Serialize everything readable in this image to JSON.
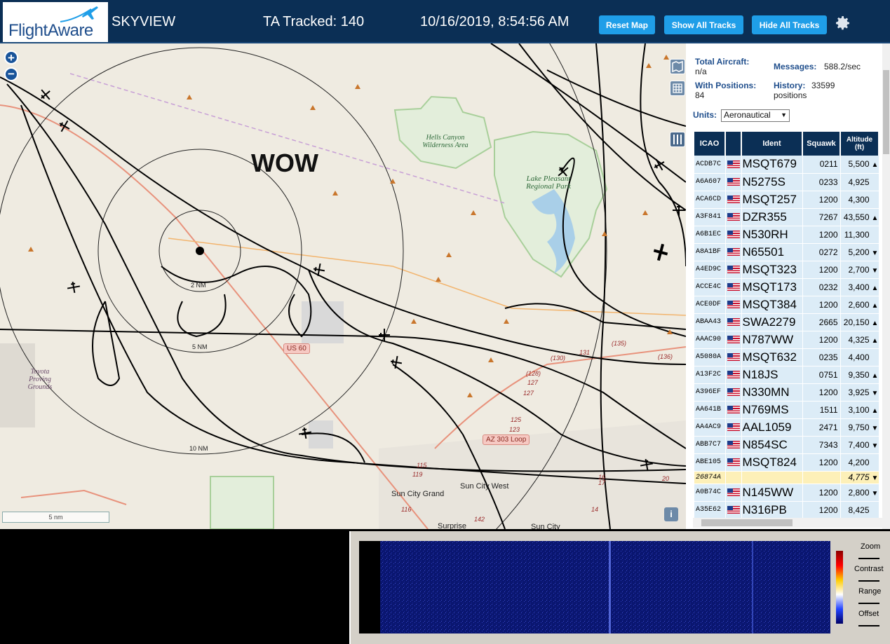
{
  "header": {
    "logo_text": "FlightAware",
    "app_name": "SKYVIEW",
    "tracked": "TA Tracked: 140",
    "datetime": "10/16/2019, 8:54:56 AM",
    "buttons": {
      "reset": "Reset Map",
      "show": "Show All Tracks",
      "hide": "Hide All Tracks"
    }
  },
  "map": {
    "overlay_text": "WOW",
    "range_labels": [
      "2 NM",
      "5 NM",
      "10 NM"
    ],
    "places": {
      "hells_canyon": "Hells Canyon Wilderness Area",
      "lake_pleasant": "Lake Pleasant Regional Park",
      "toyota": "Toyota Proving Grounds",
      "sun_city_grand": "Sun City Grand",
      "sun_city_west": "Sun City West",
      "surprise": "Surprise",
      "sun_city": "Sun City"
    },
    "shields": {
      "us60": "US 60",
      "az303": "AZ 303 Loop"
    },
    "road_numbers": [
      "(130)",
      "131",
      "(135)",
      "(136)",
      "(128)",
      "127",
      "127",
      "125",
      "123",
      "119",
      "116",
      "115",
      "142",
      "17",
      "16",
      "14",
      "20"
    ],
    "scale": "5 nm",
    "info": "i"
  },
  "sidebar": {
    "total_aircraft_label": "Total Aircraft:",
    "total_aircraft_value": "n/a",
    "with_positions_label": "With Positions:",
    "with_positions_value": "84",
    "messages_label": "Messages:",
    "messages_value": "588.2/sec",
    "history_label": "History:",
    "history_value": "33599",
    "history_unit": "positions",
    "units_label": "Units:",
    "units_value": "Aeronautical",
    "columns": [
      "ICAO",
      "",
      "Ident",
      "Squawk",
      "Altitude (ft)"
    ],
    "rows": [
      {
        "icao": "ACDB7C",
        "ident": "MSQT679",
        "squawk": "0211",
        "alt": "5,500",
        "trend": "▲"
      },
      {
        "icao": "A6A607",
        "ident": "N5275S",
        "squawk": "0233",
        "alt": "4,925",
        "trend": ""
      },
      {
        "icao": "ACA6CD",
        "ident": "MSQT257",
        "squawk": "1200",
        "alt": "4,300",
        "trend": ""
      },
      {
        "icao": "A3F841",
        "ident": "DZR355",
        "squawk": "7267",
        "alt": "43,550",
        "trend": "▲"
      },
      {
        "icao": "A6B1EC",
        "ident": "N530RH",
        "squawk": "1200",
        "alt": "11,300",
        "trend": ""
      },
      {
        "icao": "A8A1BF",
        "ident": "N65501",
        "squawk": "0272",
        "alt": "5,200",
        "trend": "▼"
      },
      {
        "icao": "A4ED9C",
        "ident": "MSQT323",
        "squawk": "1200",
        "alt": "2,700",
        "trend": "▼"
      },
      {
        "icao": "ACCE4C",
        "ident": "MSQT173",
        "squawk": "0232",
        "alt": "3,400",
        "trend": "▲"
      },
      {
        "icao": "ACE0DF",
        "ident": "MSQT384",
        "squawk": "1200",
        "alt": "2,600",
        "trend": "▲"
      },
      {
        "icao": "ABAA43",
        "ident": "SWA2279",
        "squawk": "2665",
        "alt": "20,150",
        "trend": "▲"
      },
      {
        "icao": "AAAC90",
        "ident": "N787WW",
        "squawk": "1200",
        "alt": "4,325",
        "trend": "▲"
      },
      {
        "icao": "A5080A",
        "ident": "MSQT632",
        "squawk": "0235",
        "alt": "4,400",
        "trend": ""
      },
      {
        "icao": "A13F2C",
        "ident": "N18JS",
        "squawk": "0751",
        "alt": "9,350",
        "trend": "▲"
      },
      {
        "icao": "A396EF",
        "ident": "N330MN",
        "squawk": "1200",
        "alt": "3,925",
        "trend": "▼"
      },
      {
        "icao": "AA641B",
        "ident": "N769MS",
        "squawk": "1511",
        "alt": "3,100",
        "trend": "▲"
      },
      {
        "icao": "AA4AC9",
        "ident": "AAL1059",
        "squawk": "2471",
        "alt": "9,750",
        "trend": "▼"
      },
      {
        "icao": "ABB7C7",
        "ident": "N854SC",
        "squawk": "7343",
        "alt": "7,400",
        "trend": "▼"
      },
      {
        "icao": "ABE105",
        "ident": "MSQT824",
        "squawk": "1200",
        "alt": "4,200",
        "trend": ""
      },
      {
        "icao": "26874A",
        "ident": "",
        "squawk": "",
        "alt": "4,775",
        "trend": "▼",
        "highlight": true,
        "noflag": true
      },
      {
        "icao": "A0B74C",
        "ident": "N145WW",
        "squawk": "1200",
        "alt": "2,800",
        "trend": "▼"
      },
      {
        "icao": "A35E62",
        "ident": "N316PB",
        "squawk": "1200",
        "alt": "8,425",
        "trend": ""
      }
    ]
  },
  "spectrum": {
    "controls": [
      "Zoom",
      "Contrast",
      "Range",
      "Offset"
    ]
  }
}
